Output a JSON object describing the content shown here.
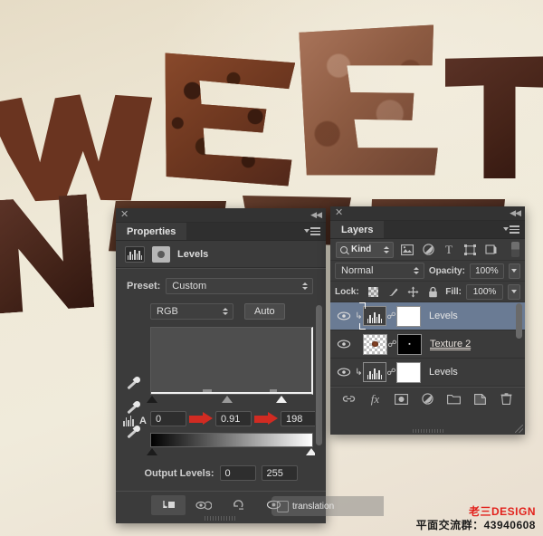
{
  "artwork": {
    "description": "chocolate-textured 3D letters on cream background",
    "letters": [
      "W",
      "E",
      "E",
      "T",
      "N"
    ],
    "background_color": "#ece5d4"
  },
  "properties_panel": {
    "close_icon": "✕",
    "collapse_icon": "◀◀",
    "tab_label": "Properties",
    "menu_icon": "panel-menu-icon",
    "header_title": "Levels",
    "header_icon_histogram": "histogram-icon",
    "header_icon_mask": "mask-circle-icon",
    "preset_label": "Preset:",
    "preset_value": "Custom",
    "channel_value": "RGB",
    "auto_button": "Auto",
    "eyedroppers": [
      "set-black-point-eyedropper",
      "set-gray-point-eyedropper",
      "set-white-point-eyedropper"
    ],
    "input_levels": {
      "black": "0",
      "gamma": "0.91",
      "white": "198"
    },
    "output_levels_label": "Output Levels:",
    "output_levels": {
      "black": "0",
      "white": "255"
    },
    "footer_buttons": [
      "clip-to-layer-icon",
      "view-previous-state-icon",
      "reset-icon",
      "toggle-visibility-icon",
      "delete-icon"
    ],
    "arrow_color": "#d12b22"
  },
  "layers_panel": {
    "close_icon": "✕",
    "collapse_icon": "◀◀",
    "tab_label": "Layers",
    "menu_icon": "panel-menu-icon",
    "filter_kind": "Kind",
    "filter_icons": [
      "filter-pixel-icon",
      "filter-adjustment-icon",
      "filter-type-icon",
      "filter-shape-icon",
      "filter-smart-object-icon"
    ],
    "blend_mode": "Normal",
    "opacity_label": "Opacity:",
    "opacity_value": "100%",
    "lock_label": "Lock:",
    "lock_icons": [
      "lock-transparent-pixels-icon",
      "lock-image-pixels-icon",
      "lock-position-icon",
      "lock-all-icon"
    ],
    "fill_label": "Fill:",
    "fill_value": "100%",
    "layers": [
      {
        "name": "Levels",
        "type": "adjustment",
        "visible": true,
        "selected": true,
        "clipped": true,
        "editing": false
      },
      {
        "name": "Texture 2",
        "type": "pixel",
        "visible": true,
        "selected": false,
        "clipped": false,
        "editing": true
      },
      {
        "name": "Levels",
        "type": "adjustment",
        "visible": true,
        "selected": false,
        "clipped": true,
        "editing": false
      }
    ],
    "footer_buttons": [
      "link-layers-icon",
      "layer-style-icon",
      "add-mask-icon",
      "new-adjustment-layer-icon",
      "new-group-icon",
      "new-layer-icon",
      "delete-layer-icon"
    ]
  },
  "tooltip_overlay": {
    "text": "translation",
    "icon": "trash-icon"
  },
  "watermark": {
    "brand": "老三DESIGN",
    "qq_group": "平面交流群：43940608",
    "brand_color": "#e2211c",
    "qq_color": "#1b1b1b"
  }
}
